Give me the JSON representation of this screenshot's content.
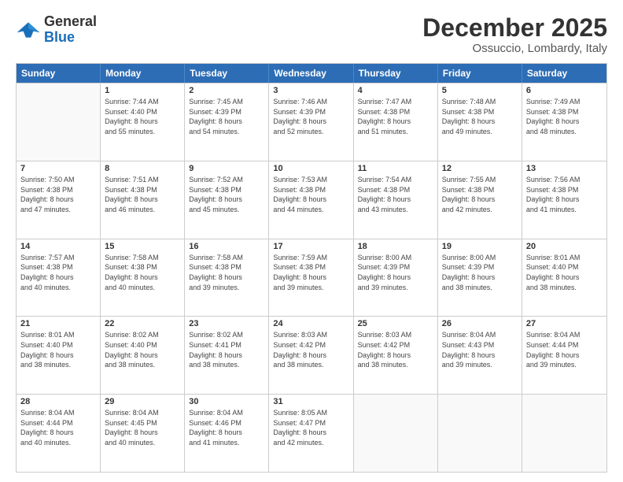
{
  "header": {
    "logo_general": "General",
    "logo_blue": "Blue",
    "month_title": "December 2025",
    "subtitle": "Ossuccio, Lombardy, Italy"
  },
  "calendar": {
    "days_of_week": [
      "Sunday",
      "Monday",
      "Tuesday",
      "Wednesday",
      "Thursday",
      "Friday",
      "Saturday"
    ],
    "rows": [
      [
        {
          "day": "",
          "info": ""
        },
        {
          "day": "1",
          "info": "Sunrise: 7:44 AM\nSunset: 4:40 PM\nDaylight: 8 hours\nand 55 minutes."
        },
        {
          "day": "2",
          "info": "Sunrise: 7:45 AM\nSunset: 4:39 PM\nDaylight: 8 hours\nand 54 minutes."
        },
        {
          "day": "3",
          "info": "Sunrise: 7:46 AM\nSunset: 4:39 PM\nDaylight: 8 hours\nand 52 minutes."
        },
        {
          "day": "4",
          "info": "Sunrise: 7:47 AM\nSunset: 4:38 PM\nDaylight: 8 hours\nand 51 minutes."
        },
        {
          "day": "5",
          "info": "Sunrise: 7:48 AM\nSunset: 4:38 PM\nDaylight: 8 hours\nand 49 minutes."
        },
        {
          "day": "6",
          "info": "Sunrise: 7:49 AM\nSunset: 4:38 PM\nDaylight: 8 hours\nand 48 minutes."
        }
      ],
      [
        {
          "day": "7",
          "info": "Sunrise: 7:50 AM\nSunset: 4:38 PM\nDaylight: 8 hours\nand 47 minutes."
        },
        {
          "day": "8",
          "info": "Sunrise: 7:51 AM\nSunset: 4:38 PM\nDaylight: 8 hours\nand 46 minutes."
        },
        {
          "day": "9",
          "info": "Sunrise: 7:52 AM\nSunset: 4:38 PM\nDaylight: 8 hours\nand 45 minutes."
        },
        {
          "day": "10",
          "info": "Sunrise: 7:53 AM\nSunset: 4:38 PM\nDaylight: 8 hours\nand 44 minutes."
        },
        {
          "day": "11",
          "info": "Sunrise: 7:54 AM\nSunset: 4:38 PM\nDaylight: 8 hours\nand 43 minutes."
        },
        {
          "day": "12",
          "info": "Sunrise: 7:55 AM\nSunset: 4:38 PM\nDaylight: 8 hours\nand 42 minutes."
        },
        {
          "day": "13",
          "info": "Sunrise: 7:56 AM\nSunset: 4:38 PM\nDaylight: 8 hours\nand 41 minutes."
        }
      ],
      [
        {
          "day": "14",
          "info": "Sunrise: 7:57 AM\nSunset: 4:38 PM\nDaylight: 8 hours\nand 40 minutes."
        },
        {
          "day": "15",
          "info": "Sunrise: 7:58 AM\nSunset: 4:38 PM\nDaylight: 8 hours\nand 40 minutes."
        },
        {
          "day": "16",
          "info": "Sunrise: 7:58 AM\nSunset: 4:38 PM\nDaylight: 8 hours\nand 39 minutes."
        },
        {
          "day": "17",
          "info": "Sunrise: 7:59 AM\nSunset: 4:38 PM\nDaylight: 8 hours\nand 39 minutes."
        },
        {
          "day": "18",
          "info": "Sunrise: 8:00 AM\nSunset: 4:39 PM\nDaylight: 8 hours\nand 39 minutes."
        },
        {
          "day": "19",
          "info": "Sunrise: 8:00 AM\nSunset: 4:39 PM\nDaylight: 8 hours\nand 38 minutes."
        },
        {
          "day": "20",
          "info": "Sunrise: 8:01 AM\nSunset: 4:40 PM\nDaylight: 8 hours\nand 38 minutes."
        }
      ],
      [
        {
          "day": "21",
          "info": "Sunrise: 8:01 AM\nSunset: 4:40 PM\nDaylight: 8 hours\nand 38 minutes."
        },
        {
          "day": "22",
          "info": "Sunrise: 8:02 AM\nSunset: 4:40 PM\nDaylight: 8 hours\nand 38 minutes."
        },
        {
          "day": "23",
          "info": "Sunrise: 8:02 AM\nSunset: 4:41 PM\nDaylight: 8 hours\nand 38 minutes."
        },
        {
          "day": "24",
          "info": "Sunrise: 8:03 AM\nSunset: 4:42 PM\nDaylight: 8 hours\nand 38 minutes."
        },
        {
          "day": "25",
          "info": "Sunrise: 8:03 AM\nSunset: 4:42 PM\nDaylight: 8 hours\nand 38 minutes."
        },
        {
          "day": "26",
          "info": "Sunrise: 8:04 AM\nSunset: 4:43 PM\nDaylight: 8 hours\nand 39 minutes."
        },
        {
          "day": "27",
          "info": "Sunrise: 8:04 AM\nSunset: 4:44 PM\nDaylight: 8 hours\nand 39 minutes."
        }
      ],
      [
        {
          "day": "28",
          "info": "Sunrise: 8:04 AM\nSunset: 4:44 PM\nDaylight: 8 hours\nand 40 minutes."
        },
        {
          "day": "29",
          "info": "Sunrise: 8:04 AM\nSunset: 4:45 PM\nDaylight: 8 hours\nand 40 minutes."
        },
        {
          "day": "30",
          "info": "Sunrise: 8:04 AM\nSunset: 4:46 PM\nDaylight: 8 hours\nand 41 minutes."
        },
        {
          "day": "31",
          "info": "Sunrise: 8:05 AM\nSunset: 4:47 PM\nDaylight: 8 hours\nand 42 minutes."
        },
        {
          "day": "",
          "info": ""
        },
        {
          "day": "",
          "info": ""
        },
        {
          "day": "",
          "info": ""
        }
      ]
    ]
  }
}
